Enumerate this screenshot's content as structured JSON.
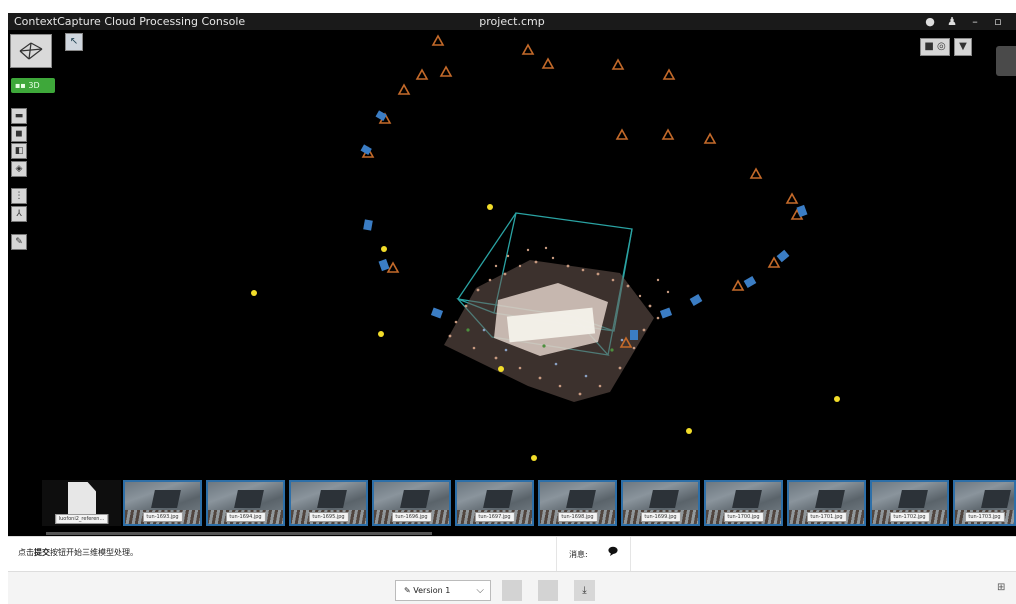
{
  "window": {
    "app_title": "ContextCapture Cloud Processing Console",
    "file_title": "project.cmp",
    "controls": [
      "bulb-icon",
      "users-icon",
      "minimize-icon",
      "maximize-icon"
    ]
  },
  "viewport": {
    "mode_label": "3D",
    "left_tools": [
      "photos-icon",
      "photogroups-icon",
      "blocks-icon",
      "control-points-icon",
      "grid-icon",
      "axes-icon",
      "measure-icon"
    ],
    "right_tools": [
      "camera-icon",
      "target-icon",
      "filter-icon"
    ]
  },
  "thumbnails": {
    "first_label": "luofoni2_referen...",
    "items": [
      "tun-1693.jpg",
      "tun-1694.jpg",
      "tun-1695.jpg",
      "tun-1696.jpg",
      "tun-1697.jpg",
      "tun-1698.jpg",
      "tun-1699.jpg",
      "tun-1700.jpg",
      "tun-1701.jpg",
      "tun-1702.jpg",
      "tun-1703.jpg"
    ]
  },
  "status": {
    "message_prefix": "点击",
    "message_bold": "提交",
    "message_suffix": "按钮开始三维模型处理。",
    "messages_label": "消息:"
  },
  "bottom": {
    "version_label": "Version 1"
  },
  "colors": {
    "accent_green": "#3ea83a",
    "thumb_border": "#2d6fa8",
    "point_yellow": "#f2dd2a",
    "cam_orange": "#c46a2a",
    "cam_blue": "#3b7dc4",
    "box_teal": "#2aa3a3"
  }
}
